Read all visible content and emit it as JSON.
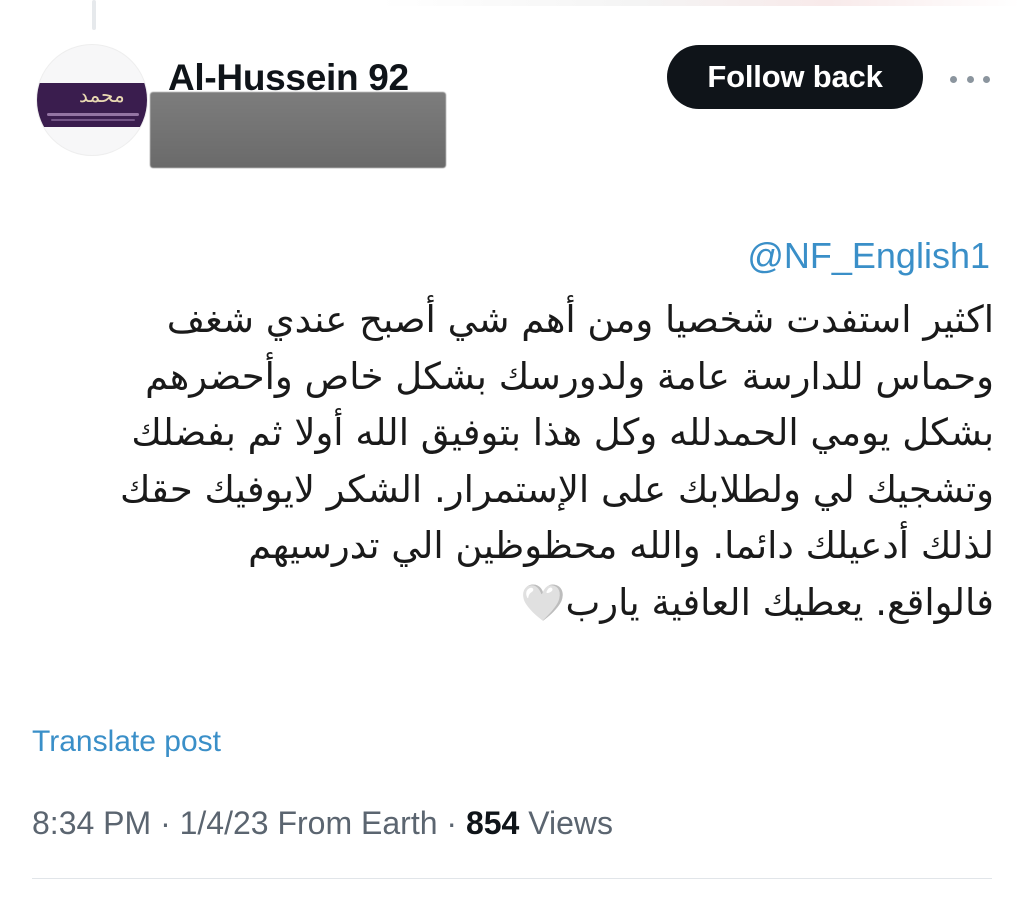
{
  "author": {
    "display_name": "Al-Hussein 92",
    "avatar_glyph": "محمد"
  },
  "actions": {
    "follow_label": "Follow back",
    "more_icon": "ellipsis-icon"
  },
  "tweet": {
    "mention": "@NF_English1",
    "lines": [
      "اكثير استفدت شخصيا ومن أهم شي أصبح عندي شغف",
      "وحماس للدارسة عامة ولدورسك بشكل خاص وأحضرهم",
      "بشكل يومي الحمدلله وكل هذا بتوفيق الله أولا ثم بفضلك",
      "وتشجيك لي ولطلابك على الإستمرار. الشكر لايوفيك حقك",
      "لذلك أدعيلك دائما. والله محظوظين الي تدرسيهم",
      "فالواقع. يعطيك العافية يارب"
    ],
    "emoji": "🤍"
  },
  "translate_label": "Translate post",
  "meta": {
    "time": "8:34 PM",
    "date": "1/4/23",
    "source": "From Earth",
    "separator": "·",
    "views_count": "854",
    "views_label": "Views"
  },
  "colors": {
    "link": "#3a8fc8",
    "button_bg": "#0f1419",
    "meta_text": "#5b6570"
  }
}
